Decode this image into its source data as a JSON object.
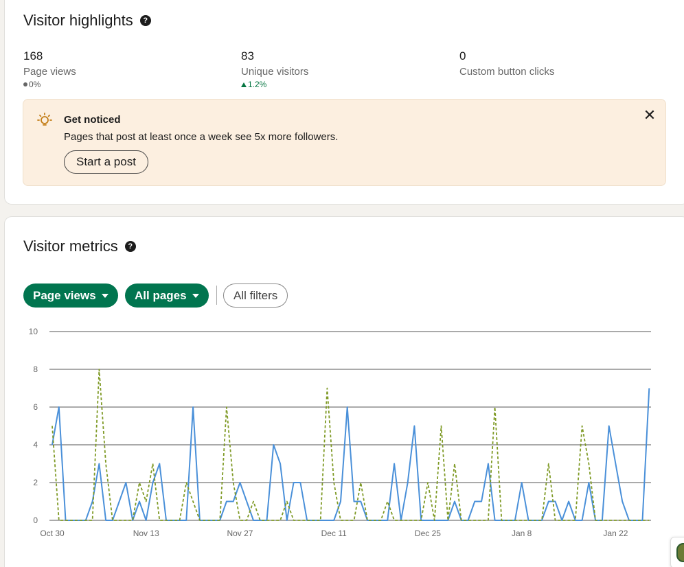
{
  "highlights": {
    "title": "Visitor highlights",
    "help_icon": "?",
    "stats": [
      {
        "value": "168",
        "label": "Page views",
        "change": "0%",
        "trend": "neutral"
      },
      {
        "value": "83",
        "label": "Unique visitors",
        "change": "1.2%",
        "trend": "up"
      },
      {
        "value": "0",
        "label": "Custom button clicks",
        "change": "",
        "trend": "none"
      }
    ],
    "notice": {
      "icon": "lightbulb-icon",
      "title": "Get noticed",
      "body": "Pages that post at least once a week see 5x more followers.",
      "button": "Start a post",
      "close": "✕"
    }
  },
  "metrics": {
    "title": "Visitor metrics",
    "help_icon": "?",
    "filters": {
      "metric": "Page views",
      "pages": "All pages",
      "all_filters": "All filters"
    }
  },
  "colors": {
    "accent_green": "#01754f",
    "series_blue": "#4a90d9",
    "series_olive": "#7f9a26",
    "notice_bg": "#fcefe0"
  },
  "chart_data": {
    "type": "line",
    "ylim": [
      0,
      10
    ],
    "yticks": [
      0,
      2,
      4,
      6,
      8,
      10
    ],
    "xtick_labels": [
      "Oct 30",
      "Nov 13",
      "Nov 27",
      "Dec 11",
      "Dec 25",
      "Jan 8",
      "Jan 22"
    ],
    "xtick_days": [
      0,
      14,
      28,
      42,
      56,
      70,
      84
    ],
    "grid": true,
    "series": [
      {
        "style": "solid",
        "color": "#4a90d9",
        "values": [
          4,
          6,
          0,
          0,
          0,
          0,
          1,
          3,
          0,
          0,
          1,
          2,
          0,
          1,
          0,
          2,
          3,
          0,
          0,
          0,
          0,
          6,
          0,
          0,
          0,
          0,
          1,
          1,
          2,
          1,
          0,
          0,
          0,
          4,
          3,
          0,
          2,
          2,
          0,
          0,
          0,
          0,
          0,
          1,
          6,
          1,
          1,
          0,
          0,
          0,
          0,
          3,
          0,
          2,
          5,
          0,
          0,
          0,
          0,
          0,
          1,
          0,
          0,
          1,
          1,
          3,
          0,
          0,
          0,
          0,
          2,
          0,
          0,
          0,
          1,
          1,
          0,
          1,
          0,
          0,
          2,
          0,
          0,
          5,
          3,
          1,
          0,
          0,
          0,
          7
        ]
      },
      {
        "style": "dashed",
        "color": "#7f9a26",
        "values": [
          5,
          0,
          0,
          0,
          0,
          0,
          0,
          8,
          3,
          0,
          0,
          0,
          0,
          2,
          1,
          3,
          0,
          0,
          0,
          0,
          2,
          1,
          0,
          0,
          0,
          0,
          6,
          2,
          0,
          0,
          1,
          0,
          0,
          0,
          0,
          1,
          0,
          0,
          0,
          0,
          0,
          7,
          2,
          0,
          0,
          0,
          2,
          0,
          0,
          0,
          1,
          0,
          0,
          0,
          0,
          0,
          2,
          0,
          5,
          0,
          3,
          0,
          0,
          0,
          0,
          0,
          6,
          0,
          0,
          0,
          0,
          0,
          0,
          0,
          3,
          0,
          0,
          0,
          0,
          5,
          3,
          0,
          0,
          0,
          0,
          0,
          0,
          0,
          0,
          0
        ]
      }
    ]
  }
}
